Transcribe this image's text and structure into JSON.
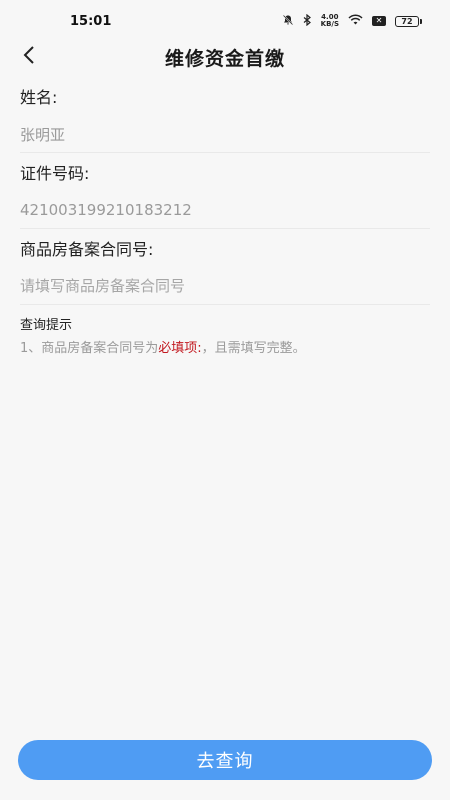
{
  "status_bar": {
    "time": "15:01",
    "net_speed_value": "4.00",
    "net_speed_unit": "KB/S",
    "battery": "72"
  },
  "nav": {
    "title": "维修资金首缴"
  },
  "form": {
    "name_label": "姓名:",
    "name_value": "张明亚",
    "id_label": "证件号码:",
    "id_value": "421003199210183212",
    "contract_label": "商品房备案合同号:",
    "contract_placeholder": "请填写商品房备案合同号"
  },
  "tips": {
    "title": "查询提示",
    "line_prefix": "1、商品房备案合同号为",
    "line_required": "必填项:",
    "line_suffix": "，且需填写完整。"
  },
  "submit_label": "去查询",
  "colors": {
    "accent": "#4f9cf3",
    "required": "#c2181f",
    "background": "#f7f7f7"
  }
}
